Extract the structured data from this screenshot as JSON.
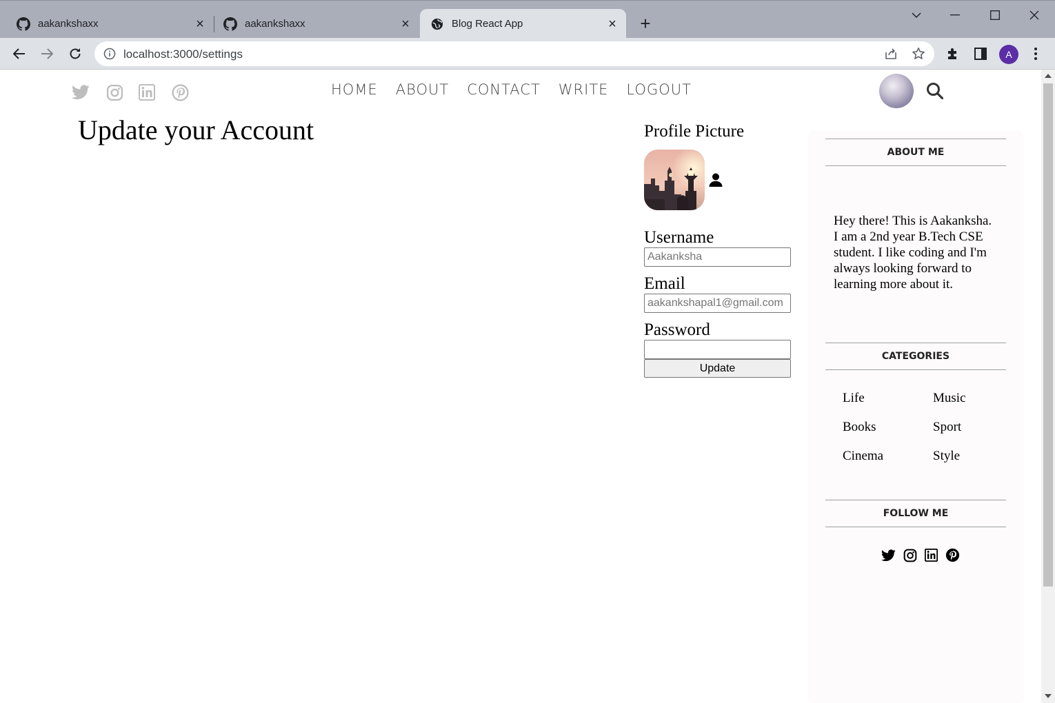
{
  "browser": {
    "tabs": [
      {
        "title": "aakankshaxx",
        "icon": "github-icon",
        "active": false
      },
      {
        "title": "aakankshaxx",
        "icon": "github-icon",
        "active": false
      },
      {
        "title": "Blog React App",
        "icon": "globe-icon",
        "active": true
      }
    ],
    "url": "localhost:3000/settings",
    "profile_initial": "A",
    "profile_color": "#5a2ea6"
  },
  "topbar": {
    "social_icons": [
      "twitter-icon",
      "instagram-icon",
      "linkedin-icon",
      "pinterest-icon"
    ],
    "nav": [
      "HOME",
      "ABOUT",
      "CONTACT",
      "WRITE",
      "LOGOUT"
    ]
  },
  "settings": {
    "title": "Update your Account",
    "profile_picture_label": "Profile Picture",
    "username_label": "Username",
    "username_placeholder": "Aakanksha",
    "email_label": "Email",
    "email_placeholder": "aakankshapal1@gmail.com",
    "password_label": "Password",
    "update_button": "Update"
  },
  "sidebar": {
    "about_title": "ABOUT ME",
    "about_text": "Hey there! This is Aakanksha. I am a 2nd year B.Tech CSE student. I like coding and I'm always looking forward to learning more about it.",
    "categories_title": "CATEGORIES",
    "categories": [
      "Life",
      "Music",
      "Books",
      "Sport",
      "Cinema",
      "Style"
    ],
    "follow_title": "FOLLOW ME",
    "follow_icons": [
      "twitter-icon",
      "instagram-icon",
      "linkedin-icon",
      "pinterest-icon"
    ]
  }
}
